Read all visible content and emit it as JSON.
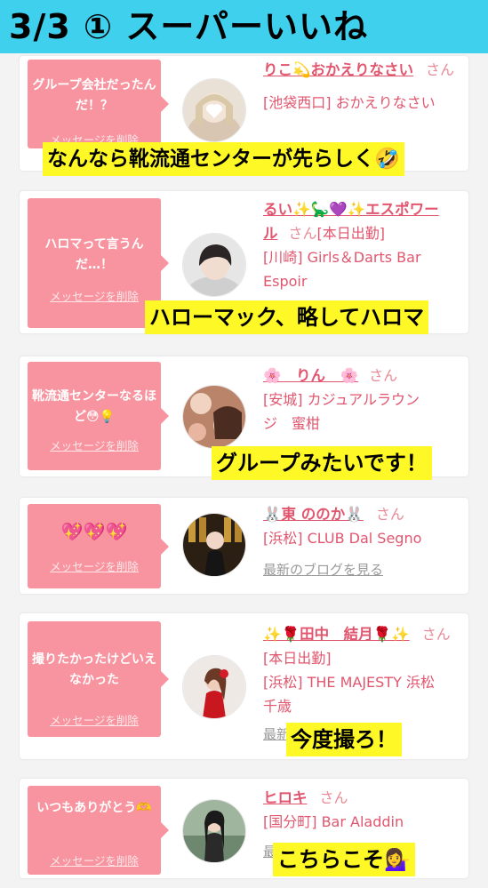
{
  "banner": {
    "title": "3/3 ① スーパーいいね"
  },
  "delete_label": "メッセージを削除",
  "latest_blog_label": "最新のブログを見る",
  "san": "さん",
  "cards": [
    {
      "message": "グループ会社だったんだ！？",
      "name_lines": [
        "りこ💫おかえりなさい"
      ],
      "shop_lines": [
        "[池袋西口] おかえりなさい"
      ],
      "caption": "なんなら靴流通センターが先らしく🤣"
    },
    {
      "message": "ハロマって言うんだ…！",
      "name_lines": [
        "るい✨🦕💜✨エスポワー",
        "ル"
      ],
      "status": "[本日出勤]",
      "shop_lines": [
        "[川崎] Girls＆Darts Bar",
        "Espoir"
      ],
      "caption": "ハローマック、略してハロマ"
    },
    {
      "message": "靴流通センターなるほど😳💡",
      "name_lines": [
        "🌸　りん　🌸"
      ],
      "shop_lines": [
        "[安城] カジュアルラウン",
        "ジ　蜜柑"
      ],
      "caption": "グループみたいです！"
    },
    {
      "message": "💖💖💖",
      "name_lines": [
        "🐰東 ののか🐰"
      ],
      "shop_lines": [
        "[浜松] CLUB Dal Segno"
      ],
      "caption": ""
    },
    {
      "message": "撮りたかったけどいえなかった",
      "name_lines": [
        "✨🌹田中　結月🌹✨"
      ],
      "status": "[本日出勤]",
      "shop_lines": [
        "[浜松] THE MAJESTY 浜松",
        "千歳"
      ],
      "caption": "今度撮ろ！"
    },
    {
      "message": "いつもありがとう🫶",
      "name_lines": [
        "ヒロキ"
      ],
      "shop_lines": [
        "[国分町] Bar Aladdin"
      ],
      "caption": "こちらこそ💁‍♀️"
    }
  ]
}
